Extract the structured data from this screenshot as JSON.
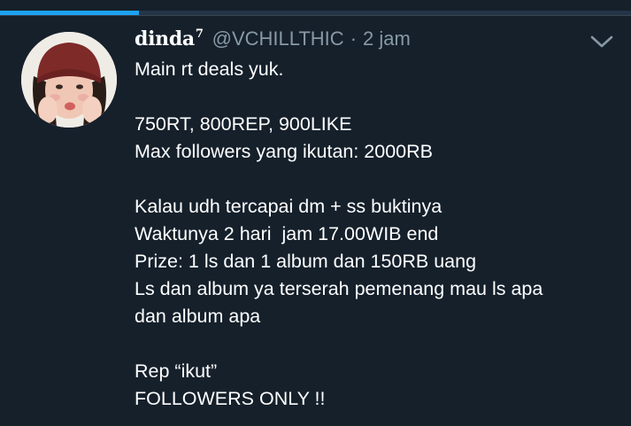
{
  "progress": {
    "fraction": 0.22,
    "color": "#1da1f2"
  },
  "tweet": {
    "display_name": "dinda",
    "display_name_sup": "7",
    "handle": "@VCHILLTHIC",
    "separator": "·",
    "time": "2 jam",
    "avatar_icon": "profile-photo",
    "menu_icon": "chevron-down-icon",
    "lines": {
      "l1": "Main rt deals yuk.",
      "l2": "750RT, 800REP, 900LIKE",
      "l3": "Max followers yang ikutan: 2000RB",
      "l4": "Kalau udh tercapai dm + ss buktinya",
      "l5": "Waktunya 2 hari  jam 17.00WIB end",
      "l6": "Prize: 1 ls dan 1 album dan 150RB uang",
      "l7": "Ls dan album ya terserah pemenang mau ls apa",
      "l8": "dan album apa",
      "l9": "Rep “ikut”",
      "l10": "FOLLOWERS ONLY !!"
    }
  },
  "colors": {
    "background": "#15202b",
    "text": "#ffffff",
    "secondary_text": "#8899a6"
  }
}
